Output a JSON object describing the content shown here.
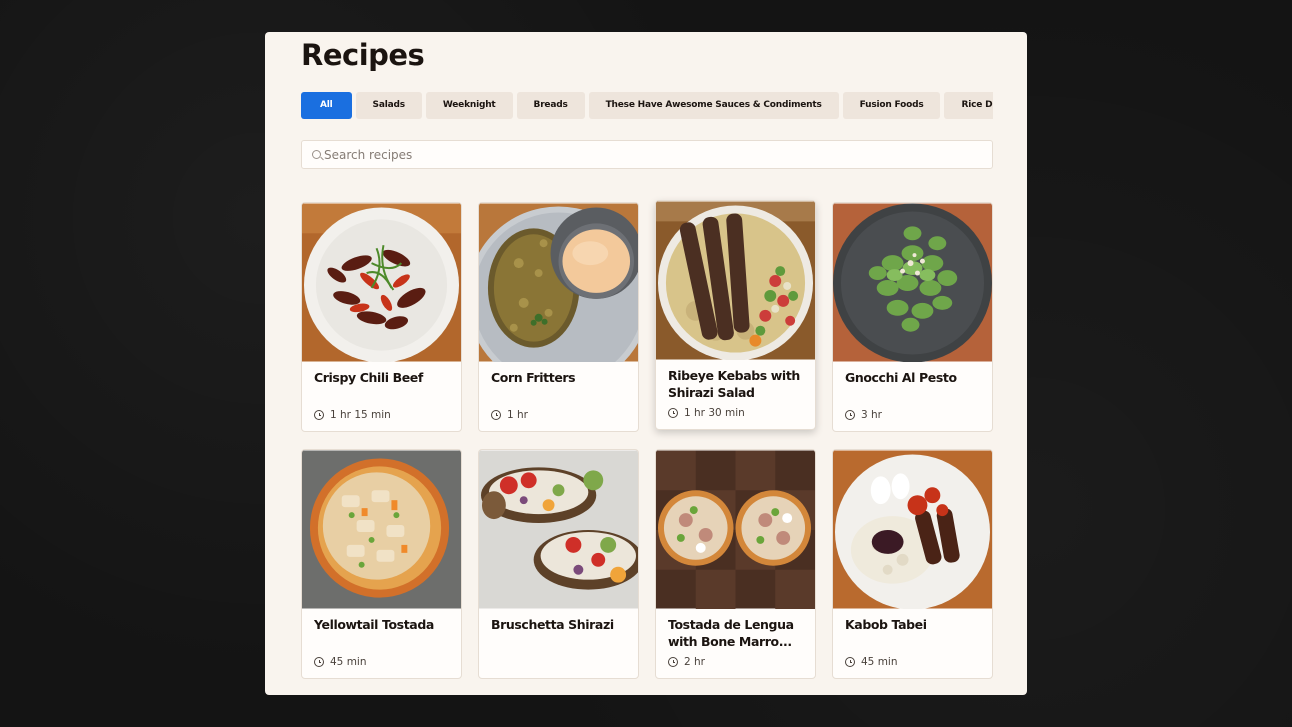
{
  "page": {
    "title": "Recipes"
  },
  "filters": [
    {
      "label": "All",
      "active": true
    },
    {
      "label": "Salads"
    },
    {
      "label": "Weeknight"
    },
    {
      "label": "Breads"
    },
    {
      "label": "These Have Awesome Sauces & Condiments"
    },
    {
      "label": "Fusion Foods"
    },
    {
      "label": "Rice Di"
    }
  ],
  "search": {
    "placeholder": "Search recipes",
    "value": ""
  },
  "recipes": [
    {
      "title": "Crispy Chili Beef",
      "time": "1 hr 15 min",
      "image": "chili-beef-photo"
    },
    {
      "title": "Corn Fritters",
      "time": "1 hr",
      "image": "corn-fritters-photo"
    },
    {
      "title": "Ribeye Kebabs with Shirazi Salad",
      "time": "1 hr 30 min",
      "image": "kebabs-photo"
    },
    {
      "title": "Gnocchi Al Pesto",
      "time": "3 hr",
      "image": "gnocchi-photo"
    },
    {
      "title": "Yellowtail Tostada",
      "time": "45 min",
      "image": "yellowtail-tostada-photo"
    },
    {
      "title": "Bruschetta Shirazi",
      "time": "",
      "image": "bruschetta-photo"
    },
    {
      "title": "Tostada de Lengua with Bone Marro...",
      "time": "2 hr",
      "image": "lengua-tostada-photo"
    },
    {
      "title": "Kabob Tabei",
      "time": "45 min",
      "image": "kabob-tabei-photo"
    }
  ],
  "colors": {
    "accent": "#1a6fe0",
    "panel": "#f9f4ee",
    "chip": "#eee5dc",
    "text": "#1b1410"
  }
}
